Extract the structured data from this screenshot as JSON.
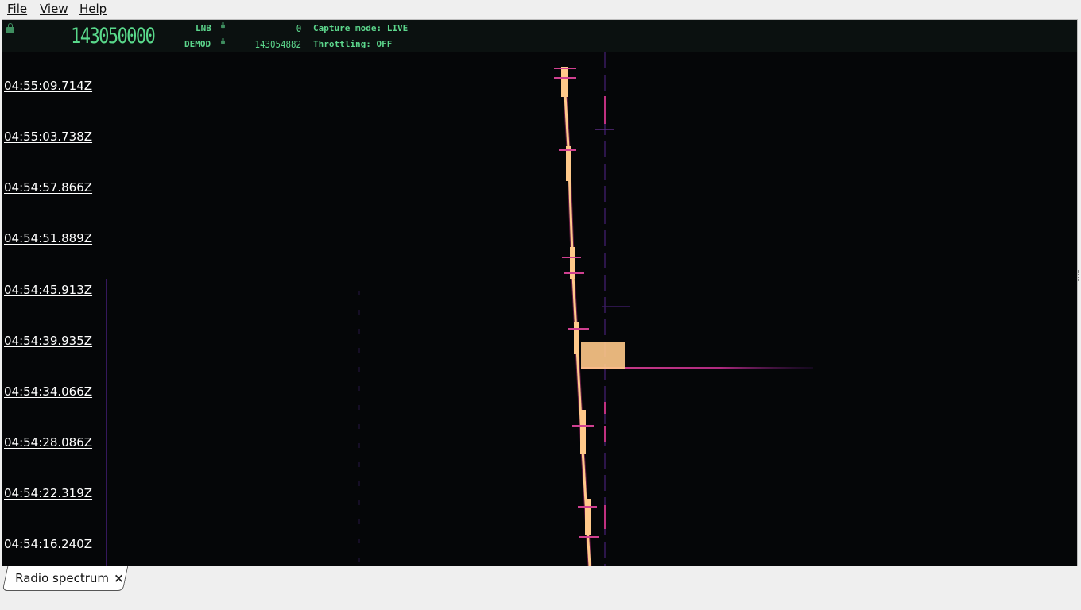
{
  "menu": {
    "file": "File",
    "view": "View",
    "help": "Help"
  },
  "status": {
    "main_frequency": "143050000",
    "lnb_label": "LNB",
    "lnb_value": "0",
    "demod_label": "DEMOD",
    "demod_value": "143054882",
    "capture_mode": "Capture mode: LIVE",
    "throttling": "Throttling: OFF"
  },
  "timestamps": [
    "04:55:09.714Z",
    "04:55:03.738Z",
    "04:54:57.866Z",
    "04:54:51.889Z",
    "04:54:45.913Z",
    "04:54:39.935Z",
    "04:54:34.066Z",
    "04:54:28.086Z",
    "04:54:22.319Z",
    "04:54:16.240Z"
  ],
  "tabs": [
    {
      "label": "Radio spectrum",
      "close": "×"
    }
  ],
  "colors": {
    "lcd_green": "#5cd68c",
    "signal_hot": "#ffc98a",
    "signal_mid": "#c2307a",
    "signal_low": "#4a2070",
    "background": "#050608"
  },
  "icons": {
    "lock": "lock-icon",
    "close": "close-icon"
  }
}
